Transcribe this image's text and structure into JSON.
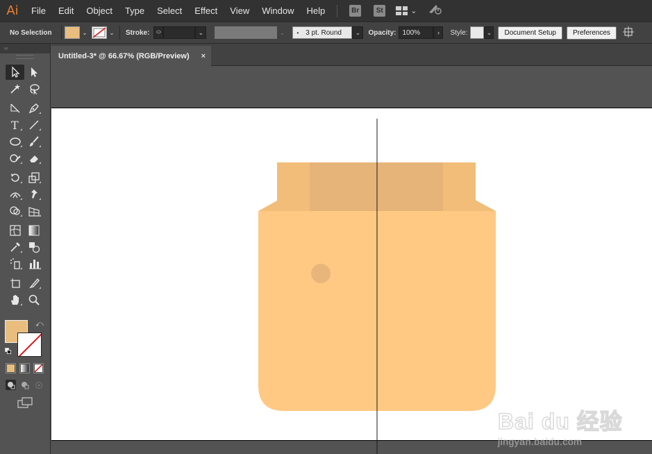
{
  "app": {
    "logo": "Ai",
    "menu": [
      "File",
      "Edit",
      "Object",
      "Type",
      "Select",
      "Effect",
      "View",
      "Window",
      "Help"
    ],
    "bridge_badge": "Br",
    "stock_badge": "St"
  },
  "controlbar": {
    "selection_status": "No Selection",
    "fill_color": "#e8bd7e",
    "stroke_label": "Stroke:",
    "stroke_weight": "",
    "brush_label": "3 pt. Round",
    "opacity_label": "Opacity:",
    "opacity_value": "100%",
    "style_label": "Style:",
    "document_setup_button": "Document Setup",
    "preferences_button": "Preferences"
  },
  "toolbar": {
    "header_glyph": "‹‹",
    "active_tool": "selection-tool",
    "fill_color": "#e8bd7e",
    "stroke_color": "none"
  },
  "document": {
    "tab_title": "Untitled-3* @ 66.67% (RGB/Preview)",
    "close_glyph": "×"
  },
  "artwork": {
    "bag_color": "#ffc983",
    "bag_shadow_color": "#f2bd78",
    "bag_inner_color": "#e6b478",
    "dot_color": "#e8b67a",
    "guide_line_color": "#1a1a1a"
  },
  "watermark": {
    "brand": "Bai du 经验",
    "site": "jingyan.baidu.com"
  }
}
